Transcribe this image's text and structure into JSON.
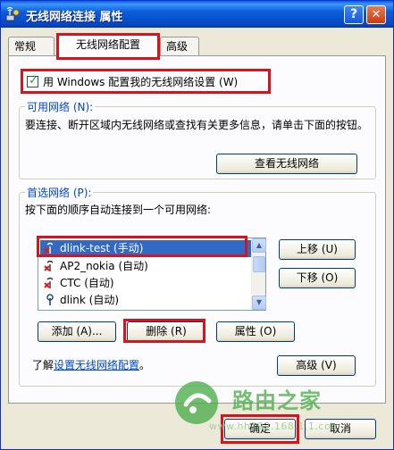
{
  "window": {
    "title": "无线网络连接  属性",
    "help_glyph": "?",
    "close_glyph": "✕"
  },
  "tabs": [
    {
      "label": "常规"
    },
    {
      "label": "无线网络配置"
    },
    {
      "label": "高级"
    }
  ],
  "use_windows": {
    "label": "用 Windows 配置我的无线网络设置 (W)",
    "checked": true
  },
  "available": {
    "title": "可用网络 (N):",
    "description": "要连接、断开区域内无线网络或查找有关更多信息，请单击下面的按钮。",
    "view_button": "查看无线网络"
  },
  "preferred": {
    "title": "首选网络 (P):",
    "description": "按下面的顺序自动连接到一个可用网络:",
    "networks": [
      {
        "name": "dlink-test (手动)",
        "icon": "wireless-antenna-red-x-icon"
      },
      {
        "name": "AP2_nokia (自动)",
        "icon": "wireless-antenna-red-x-icon"
      },
      {
        "name": "CTC (自动)",
        "icon": "wireless-antenna-red-x-icon"
      },
      {
        "name": "dlink (自动)",
        "icon": "wireless-antenna-icon"
      }
    ],
    "move_up": "上移 (U)",
    "move_down": "下移 (O)",
    "add": "添加 (A)...",
    "remove": "删除 (R)",
    "properties": "属性 (O)"
  },
  "learn": {
    "prefix": "了解",
    "link": "设置无线网络配置",
    "suffix": "。"
  },
  "advanced_button": "高级 (V)",
  "ok_button": "确定",
  "cancel_button": "取消",
  "watermark": {
    "brand": "路由之家",
    "url": "www.hh192.168.1.1.com"
  },
  "colors": {
    "highlight": "#d4151d",
    "selection": "#316ac5",
    "title_bar": "#0a5fd8"
  }
}
